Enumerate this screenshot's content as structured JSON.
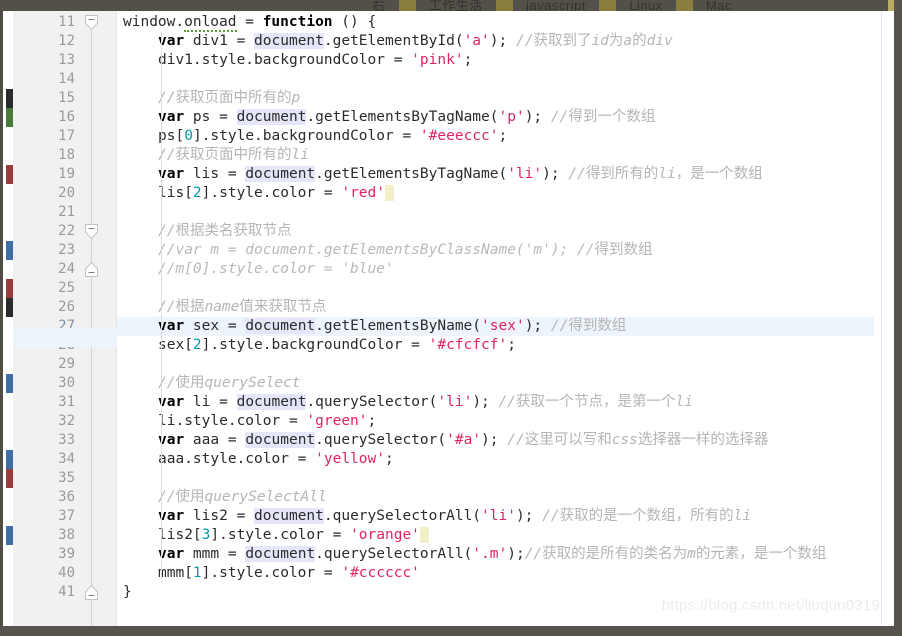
{
  "browser_tags": {
    "items": [
      "右",
      "工作生活",
      "javascript",
      "Linux",
      "Mac"
    ]
  },
  "editor": {
    "first_line": 11,
    "current_line": 27,
    "watermark": "https://blog.csdn.net/liuqun0319",
    "colors": {
      "background": "#ffffff",
      "gutter": "#f1f1f1",
      "current_line": "#edf4fb",
      "string": "#e0245e",
      "number": "#0099a8",
      "comment": "#b5b5b5",
      "doc_highlight": "#e6e6fa",
      "selection": "#f2efc8",
      "frame": "#57544e"
    },
    "line_numbers": [
      11,
      12,
      13,
      14,
      15,
      16,
      17,
      18,
      19,
      20,
      21,
      22,
      23,
      24,
      25,
      26,
      27,
      28,
      29,
      30,
      31,
      32,
      33,
      34,
      35,
      36,
      37,
      38,
      39,
      40,
      41
    ],
    "lines": [
      {
        "n": 11,
        "indent": 0,
        "tokens": [
          {
            "t": "window.",
            "c": "plain"
          },
          {
            "t": "onload",
            "c": "plain squig"
          },
          {
            "t": " = ",
            "c": "plain"
          },
          {
            "t": "function",
            "c": "kw"
          },
          {
            "t": " () {",
            "c": "plain"
          }
        ]
      },
      {
        "n": 12,
        "indent": 1,
        "tokens": [
          {
            "t": "var",
            "c": "kw"
          },
          {
            "t": " div1 = ",
            "c": "plain"
          },
          {
            "t": "document",
            "c": "doc"
          },
          {
            "t": ".getElementById(",
            "c": "plain"
          },
          {
            "t": "'a'",
            "c": "str"
          },
          {
            "t": "); ",
            "c": "plain"
          },
          {
            "t": "//",
            "c": "cmt"
          },
          {
            "t": "获取到了",
            "c": "cmt-cn"
          },
          {
            "t": "id",
            "c": "cmt"
          },
          {
            "t": "为",
            "c": "cmt-cn"
          },
          {
            "t": "a",
            "c": "cmt"
          },
          {
            "t": "的",
            "c": "cmt-cn"
          },
          {
            "t": "div",
            "c": "cmt"
          }
        ]
      },
      {
        "n": 13,
        "indent": 1,
        "tokens": [
          {
            "t": "div1.style.backgroundColor = ",
            "c": "plain"
          },
          {
            "t": "'pink'",
            "c": "str"
          },
          {
            "t": ";",
            "c": "plain"
          }
        ]
      },
      {
        "n": 14,
        "indent": 0,
        "tokens": []
      },
      {
        "n": 15,
        "indent": 1,
        "tokens": [
          {
            "t": "//",
            "c": "cmt"
          },
          {
            "t": "获取页面中所有的",
            "c": "cmt-cn"
          },
          {
            "t": "p",
            "c": "cmt"
          }
        ]
      },
      {
        "n": 16,
        "indent": 1,
        "tokens": [
          {
            "t": "var",
            "c": "kw"
          },
          {
            "t": " ps = ",
            "c": "plain"
          },
          {
            "t": "document",
            "c": "doc"
          },
          {
            "t": ".getElementsByTagName(",
            "c": "plain"
          },
          {
            "t": "'p'",
            "c": "str"
          },
          {
            "t": "); ",
            "c": "plain"
          },
          {
            "t": "//",
            "c": "cmt"
          },
          {
            "t": "得到一个数组",
            "c": "cmt-cn"
          }
        ]
      },
      {
        "n": 17,
        "indent": 1,
        "tokens": [
          {
            "t": "ps[",
            "c": "plain"
          },
          {
            "t": "0",
            "c": "num"
          },
          {
            "t": "].style.backgroundColor = ",
            "c": "plain"
          },
          {
            "t": "'#eeeccc'",
            "c": "str"
          },
          {
            "t": ";",
            "c": "plain"
          }
        ]
      },
      {
        "n": 18,
        "indent": 1,
        "tokens": [
          {
            "t": "//",
            "c": "cmt"
          },
          {
            "t": "获取页面中所有的",
            "c": "cmt-cn"
          },
          {
            "t": "li",
            "c": "cmt"
          }
        ]
      },
      {
        "n": 19,
        "indent": 1,
        "tokens": [
          {
            "t": "var",
            "c": "kw"
          },
          {
            "t": " lis = ",
            "c": "plain"
          },
          {
            "t": "document",
            "c": "doc"
          },
          {
            "t": ".getElementsByTagName(",
            "c": "plain"
          },
          {
            "t": "'li'",
            "c": "str"
          },
          {
            "t": "); ",
            "c": "plain"
          },
          {
            "t": "//",
            "c": "cmt"
          },
          {
            "t": "得到所有的",
            "c": "cmt-cn"
          },
          {
            "t": "li",
            "c": "cmt"
          },
          {
            "t": "，是一个数组",
            "c": "cmt-cn"
          }
        ]
      },
      {
        "n": 20,
        "indent": 1,
        "tokens": [
          {
            "t": "lis[",
            "c": "plain"
          },
          {
            "t": "2",
            "c": "num"
          },
          {
            "t": "].style.color = ",
            "c": "plain"
          },
          {
            "t": "'red'",
            "c": "str"
          },
          {
            "t": " ",
            "c": "sel"
          }
        ]
      },
      {
        "n": 21,
        "indent": 0,
        "tokens": []
      },
      {
        "n": 22,
        "indent": 1,
        "tokens": [
          {
            "t": "//",
            "c": "cmt"
          },
          {
            "t": "根据类名获取节点",
            "c": "cmt-cn"
          }
        ]
      },
      {
        "n": 23,
        "indent": 1,
        "tokens": [
          {
            "t": "//var m = document.getElementsByClassName('m'); //",
            "c": "cmt-code"
          },
          {
            "t": "得到数组",
            "c": "cmt-cn"
          }
        ]
      },
      {
        "n": 24,
        "indent": 1,
        "tokens": [
          {
            "t": "//m[0].style.color = 'blue'",
            "c": "cmt-code"
          }
        ]
      },
      {
        "n": 25,
        "indent": 0,
        "tokens": []
      },
      {
        "n": 26,
        "indent": 1,
        "tokens": [
          {
            "t": "//",
            "c": "cmt"
          },
          {
            "t": "根据",
            "c": "cmt-cn"
          },
          {
            "t": "name",
            "c": "cmt"
          },
          {
            "t": "值来获取节点",
            "c": "cmt-cn"
          }
        ]
      },
      {
        "n": 27,
        "indent": 1,
        "tokens": [
          {
            "t": "var",
            "c": "kw"
          },
          {
            "t": " sex = ",
            "c": "plain"
          },
          {
            "t": "document",
            "c": "doc"
          },
          {
            "t": ".getElementsByName(",
            "c": "plain"
          },
          {
            "t": "'sex'",
            "c": "str"
          },
          {
            "t": "); ",
            "c": "plain"
          },
          {
            "t": "//",
            "c": "cmt"
          },
          {
            "t": "得到数组",
            "c": "cmt-cn"
          }
        ]
      },
      {
        "n": 28,
        "indent": 1,
        "tokens": [
          {
            "t": "sex[",
            "c": "plain"
          },
          {
            "t": "2",
            "c": "num"
          },
          {
            "t": "].style.backgroundColor = ",
            "c": "plain"
          },
          {
            "t": "'#cfcfcf'",
            "c": "str"
          },
          {
            "t": ";",
            "c": "plain"
          }
        ]
      },
      {
        "n": 29,
        "indent": 0,
        "tokens": []
      },
      {
        "n": 30,
        "indent": 1,
        "tokens": [
          {
            "t": "//",
            "c": "cmt"
          },
          {
            "t": "使用",
            "c": "cmt-cn"
          },
          {
            "t": "querySelect",
            "c": "cmt"
          }
        ]
      },
      {
        "n": 31,
        "indent": 1,
        "tokens": [
          {
            "t": "var",
            "c": "kw"
          },
          {
            "t": " li = ",
            "c": "plain"
          },
          {
            "t": "document",
            "c": "doc"
          },
          {
            "t": ".querySelector(",
            "c": "plain"
          },
          {
            "t": "'li'",
            "c": "str"
          },
          {
            "t": "); ",
            "c": "plain"
          },
          {
            "t": "//",
            "c": "cmt"
          },
          {
            "t": "获取一个节点，是第一个",
            "c": "cmt-cn"
          },
          {
            "t": "li",
            "c": "cmt"
          }
        ]
      },
      {
        "n": 32,
        "indent": 1,
        "tokens": [
          {
            "t": "li.style.color = ",
            "c": "plain"
          },
          {
            "t": "'green'",
            "c": "str"
          },
          {
            "t": ";",
            "c": "plain"
          }
        ]
      },
      {
        "n": 33,
        "indent": 1,
        "tokens": [
          {
            "t": "var",
            "c": "kw"
          },
          {
            "t": " aaa = ",
            "c": "plain"
          },
          {
            "t": "document",
            "c": "doc"
          },
          {
            "t": ".querySelector(",
            "c": "plain"
          },
          {
            "t": "'#a'",
            "c": "str"
          },
          {
            "t": "); ",
            "c": "plain"
          },
          {
            "t": "//",
            "c": "cmt"
          },
          {
            "t": "这里可以写和",
            "c": "cmt-cn"
          },
          {
            "t": "css",
            "c": "cmt"
          },
          {
            "t": "选择器一样的选择器",
            "c": "cmt-cn"
          }
        ]
      },
      {
        "n": 34,
        "indent": 1,
        "tokens": [
          {
            "t": "aaa.style.color = ",
            "c": "plain"
          },
          {
            "t": "'yellow'",
            "c": "str"
          },
          {
            "t": ";",
            "c": "plain"
          }
        ]
      },
      {
        "n": 35,
        "indent": 0,
        "tokens": []
      },
      {
        "n": 36,
        "indent": 1,
        "tokens": [
          {
            "t": "//",
            "c": "cmt"
          },
          {
            "t": "使用",
            "c": "cmt-cn"
          },
          {
            "t": "querySelectAll",
            "c": "cmt"
          }
        ]
      },
      {
        "n": 37,
        "indent": 1,
        "tokens": [
          {
            "t": "var",
            "c": "kw"
          },
          {
            "t": " lis2 = ",
            "c": "plain"
          },
          {
            "t": "document",
            "c": "doc"
          },
          {
            "t": ".querySelectorAll(",
            "c": "plain"
          },
          {
            "t": "'li'",
            "c": "str"
          },
          {
            "t": "); ",
            "c": "plain"
          },
          {
            "t": "//",
            "c": "cmt"
          },
          {
            "t": "获取的是一个数组，所有的",
            "c": "cmt-cn"
          },
          {
            "t": "li",
            "c": "cmt"
          }
        ]
      },
      {
        "n": 38,
        "indent": 1,
        "tokens": [
          {
            "t": "lis2[",
            "c": "plain"
          },
          {
            "t": "3",
            "c": "num"
          },
          {
            "t": "].style.color = ",
            "c": "plain"
          },
          {
            "t": "'orange'",
            "c": "str"
          },
          {
            "t": " ",
            "c": "sel"
          }
        ]
      },
      {
        "n": 39,
        "indent": 1,
        "tokens": [
          {
            "t": "var",
            "c": "kw"
          },
          {
            "t": " mmm = ",
            "c": "plain"
          },
          {
            "t": "document",
            "c": "doc"
          },
          {
            "t": ".querySelectorAll(",
            "c": "plain"
          },
          {
            "t": "'.m'",
            "c": "str"
          },
          {
            "t": ");",
            "c": "plain"
          },
          {
            "t": "//",
            "c": "cmt"
          },
          {
            "t": "获取的是所有的类名为",
            "c": "cmt-cn"
          },
          {
            "t": "m",
            "c": "cmt"
          },
          {
            "t": "的元素，是一个数组",
            "c": "cmt-cn"
          }
        ]
      },
      {
        "n": 40,
        "indent": 1,
        "tokens": [
          {
            "t": "mmm[",
            "c": "plain"
          },
          {
            "t": "1",
            "c": "num"
          },
          {
            "t": "].style.color = ",
            "c": "plain"
          },
          {
            "t": "'#cccccc'",
            "c": "str"
          }
        ]
      },
      {
        "n": 41,
        "indent": 0,
        "tokens": [
          {
            "t": "}",
            "c": "plain"
          }
        ]
      }
    ],
    "fold_markers": [
      {
        "line": 11,
        "type": "collapse"
      },
      {
        "line": 22,
        "type": "collapse"
      },
      {
        "line": 24,
        "type": "end"
      },
      {
        "line": 41,
        "type": "end"
      }
    ],
    "vcs_marks": [
      {
        "line": 15,
        "color": "dark"
      },
      {
        "line": 16,
        "color": "green"
      },
      {
        "line": 19,
        "color": "red"
      },
      {
        "line": 23,
        "color": "blue"
      },
      {
        "line": 25,
        "color": "red"
      },
      {
        "line": 26,
        "color": "dark"
      },
      {
        "line": 30,
        "color": "blue"
      },
      {
        "line": 34,
        "color": "blue"
      },
      {
        "line": 35,
        "color": "red"
      },
      {
        "line": 38,
        "color": "blue"
      }
    ]
  }
}
